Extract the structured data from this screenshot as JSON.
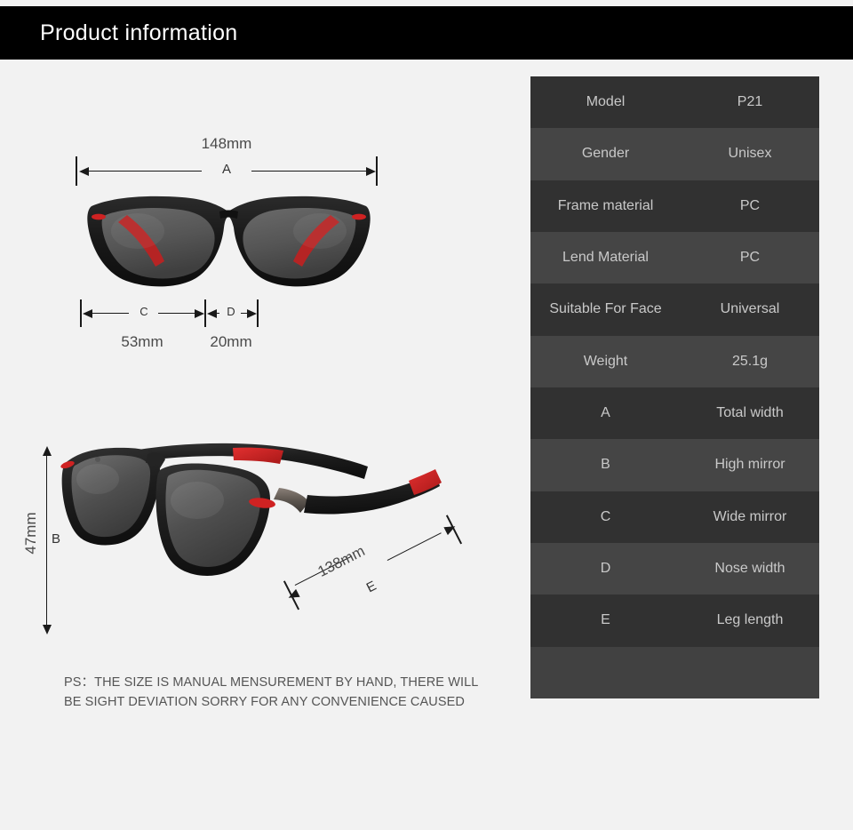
{
  "header": {
    "title": "Product information"
  },
  "diagram": {
    "front_view": {
      "icon": "sunglasses-front-icon",
      "dimension_a": {
        "label": "A",
        "value": "148mm",
        "meaning": "Total width"
      },
      "dimension_c": {
        "label": "C",
        "value": "53mm",
        "meaning": "Wide mirror"
      },
      "dimension_d": {
        "label": "D",
        "value": "20mm",
        "meaning": "Nose width"
      }
    },
    "angled_view": {
      "icon": "sunglasses-angled-icon",
      "dimension_b": {
        "label": "B",
        "value": "47mm",
        "meaning": "High mirror"
      },
      "dimension_e": {
        "label": "E",
        "value": "138mm",
        "meaning": "Leg length"
      }
    },
    "note": "PS：THE SIZE IS MANUAL MENSUREMENT BY HAND, THERE WILL BE SIGHT DEVIATION SORRY FOR ANY CONVENIENCE CAUSED"
  },
  "spec_table": {
    "rows": [
      {
        "key": "Model",
        "value": "P21"
      },
      {
        "key": "Gender",
        "value": "Unisex"
      },
      {
        "key": "Frame material",
        "value": "PC"
      },
      {
        "key": "Lend Material",
        "value": "PC"
      },
      {
        "key": "Suitable For Face",
        "value": "Universal"
      },
      {
        "key": "Weight",
        "value": "25.1g"
      },
      {
        "key": "A",
        "value": "Total width"
      },
      {
        "key": "B",
        "value": "High mirror"
      },
      {
        "key": "C",
        "value": "Wide mirror"
      },
      {
        "key": "D",
        "value": "Nose width"
      },
      {
        "key": "E",
        "value": "Leg length"
      },
      {
        "key": "",
        "value": ""
      }
    ]
  },
  "colors": {
    "banner_bg": "#000000",
    "banner_text": "#ffffff",
    "page_bg": "#f2f2f2",
    "row_dark": "#313131",
    "row_light": "#454545",
    "row_empty": "#414141",
    "table_text": "#c9c9c9",
    "dimension_line": "#1a1a1a",
    "dimension_text": "#4a4a4a",
    "frame_black": "#1c1c1c",
    "lens_gray": "#565656",
    "accent_red": "#d21f1f"
  }
}
